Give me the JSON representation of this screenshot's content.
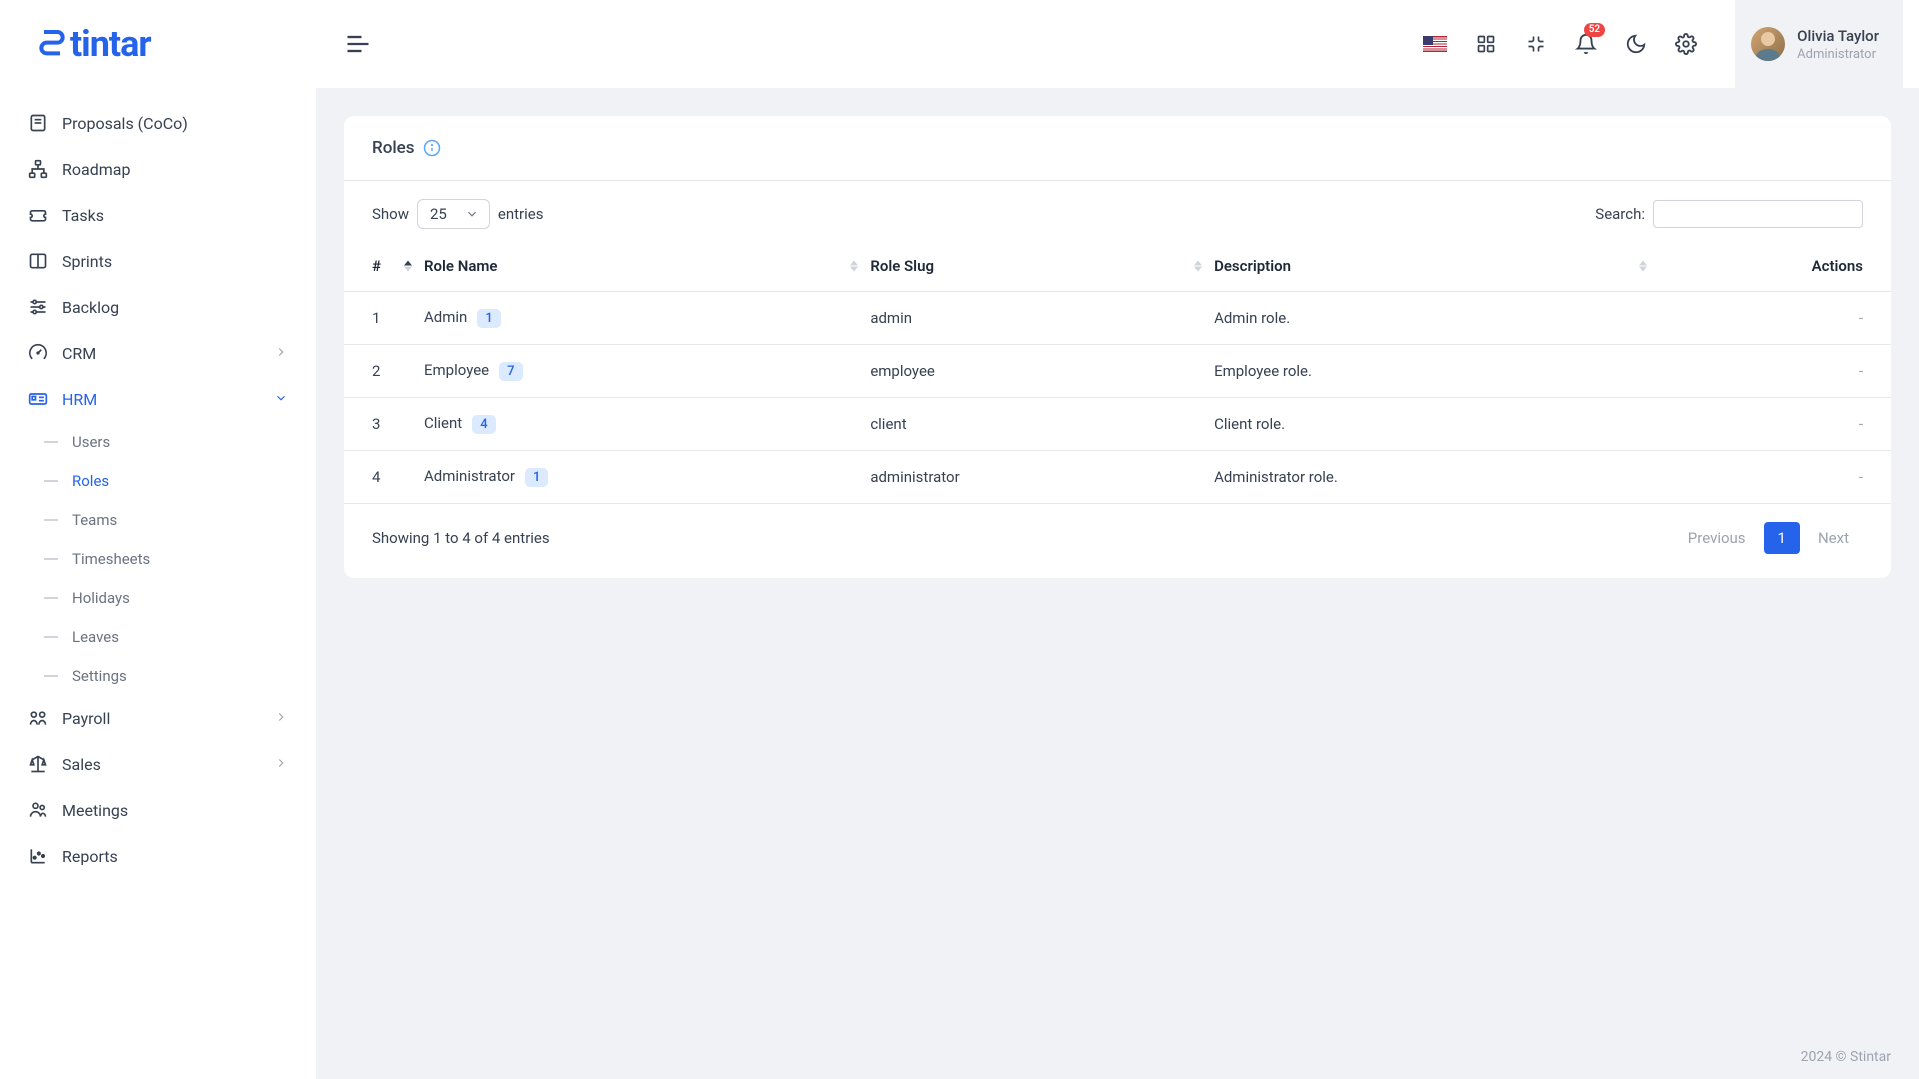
{
  "brand": "tintar",
  "header": {
    "notification_count": "52",
    "user_name": "Olivia Taylor",
    "user_role": "Administrator"
  },
  "sidebar": {
    "items": [
      {
        "label": "Proposals (CoCo)"
      },
      {
        "label": "Roadmap"
      },
      {
        "label": "Tasks"
      },
      {
        "label": "Sprints"
      },
      {
        "label": "Backlog"
      },
      {
        "label": "CRM"
      },
      {
        "label": "HRM"
      },
      {
        "label": "Payroll"
      },
      {
        "label": "Sales"
      },
      {
        "label": "Meetings"
      },
      {
        "label": "Reports"
      }
    ],
    "hrm_sub": [
      {
        "label": "Users"
      },
      {
        "label": "Roles"
      },
      {
        "label": "Teams"
      },
      {
        "label": "Timesheets"
      },
      {
        "label": "Holidays"
      },
      {
        "label": "Leaves"
      },
      {
        "label": "Settings"
      }
    ]
  },
  "page": {
    "title": "Roles",
    "show_label": "Show",
    "page_size": "25",
    "entries_label": "entries",
    "search_label": "Search:",
    "columns": {
      "idx": "#",
      "name": "Role Name",
      "slug": "Role Slug",
      "desc": "Description",
      "actions": "Actions"
    },
    "rows": [
      {
        "idx": "1",
        "name": "Admin",
        "count": "1",
        "slug": "admin",
        "desc": "Admin role.",
        "actions": "-"
      },
      {
        "idx": "2",
        "name": "Employee",
        "count": "7",
        "slug": "employee",
        "desc": "Employee role.",
        "actions": "-"
      },
      {
        "idx": "3",
        "name": "Client",
        "count": "4",
        "slug": "client",
        "desc": "Client role.",
        "actions": "-"
      },
      {
        "idx": "4",
        "name": "Administrator",
        "count": "1",
        "slug": "administrator",
        "desc": "Administrator role.",
        "actions": "-"
      }
    ],
    "footer_info": "Showing 1 to 4 of 4 entries",
    "prev": "Previous",
    "page1": "1",
    "next": "Next"
  },
  "footer": "2024 © Stintar"
}
